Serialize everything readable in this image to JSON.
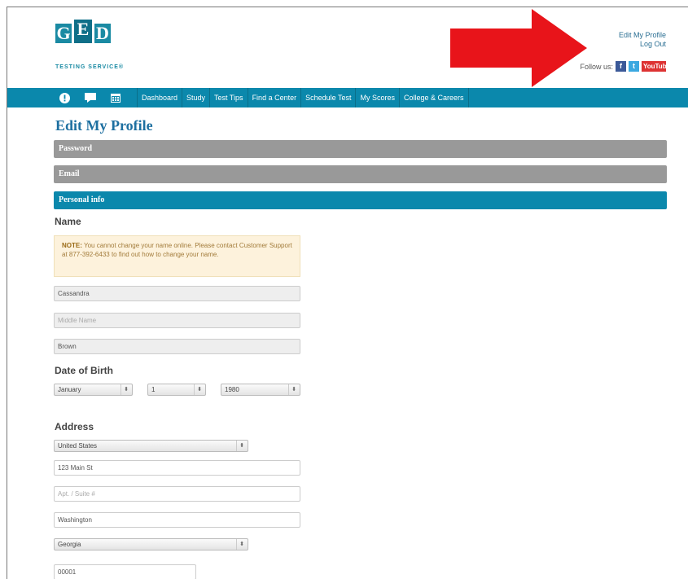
{
  "header": {
    "logo": {
      "letters": [
        "G",
        "E",
        "D"
      ],
      "subtitle": "TESTING SERVICE®"
    },
    "top_links": {
      "edit_profile": "Edit My Profile",
      "log_out": "Log Out"
    },
    "follow_label": "Follow us:",
    "social": {
      "facebook": "f",
      "twitter": "t",
      "youtube": "YouTube"
    },
    "annotation_arrow_color": "#e8141a"
  },
  "nav": {
    "icons": [
      "alert-icon",
      "chat-icon",
      "calendar-icon"
    ],
    "items": [
      "Dashboard",
      "Study",
      "Test Tips",
      "Find a Center",
      "Schedule Test",
      "My Scores",
      "College & Careers"
    ]
  },
  "page": {
    "title": "Edit My Profile",
    "sections": {
      "password": "Password",
      "email": "Email",
      "personal_info": "Personal info"
    },
    "name": {
      "heading": "Name",
      "note_label": "NOTE:",
      "note_text": " You cannot change your name online. Please contact Customer Support at 877-392-6433 to find out how to change your name.",
      "first": "Cassandra",
      "middle_placeholder": "Middle Name",
      "last": "Brown"
    },
    "dob": {
      "heading": "Date of Birth",
      "month": "January",
      "day": "1",
      "year": "1980"
    },
    "address": {
      "heading": "Address",
      "country": "United States",
      "street": "123 Main St",
      "apt_placeholder": "Apt. / Suite #",
      "city": "Washington",
      "state": "Georgia",
      "zip": "00001"
    }
  },
  "colors": {
    "brand_teal": "#0b88ac",
    "section_grey": "#999999",
    "title_blue": "#1d6fa0",
    "note_bg": "#fdf2dc"
  }
}
